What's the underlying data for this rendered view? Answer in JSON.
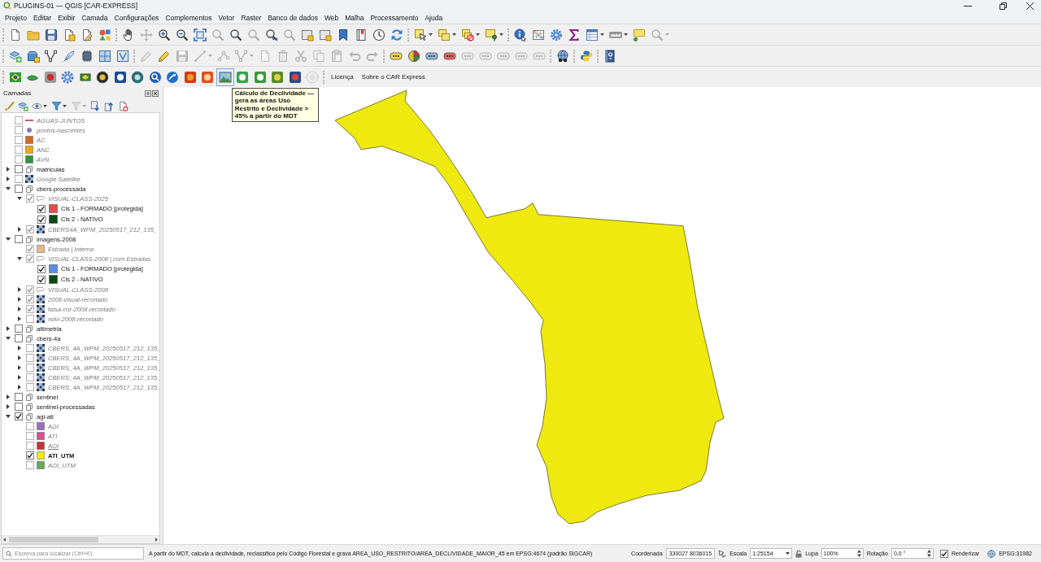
{
  "window": {
    "title": "PLUGINS-01 — QGIS [CAR-EXPRESS]"
  },
  "menu": [
    "Projeto",
    "Editar",
    "Exibir",
    "Camada",
    "Configurações",
    "Complementos",
    "Vetor",
    "Raster",
    "Banco de dados",
    "Web",
    "Malha",
    "Processamento",
    "Ajuda"
  ],
  "toolbars": [
    {
      "buttons": [
        {
          "disabled": false
        },
        {
          "disabled": false
        },
        {
          "disabled": false
        },
        {
          "disabled": false
        },
        {
          "disabled": false
        },
        {
          "disabled": false
        },
        {
          "disabled": false
        },
        {
          "disabled": true
        },
        {
          "disabled": false
        },
        {
          "disabled": false
        },
        {
          "disabled": false
        },
        {
          "disabled": true
        },
        {
          "disabled": false
        },
        {
          "disabled": true
        },
        {
          "disabled": false
        },
        {
          "disabled": true
        },
        {
          "disabled": false
        },
        {
          "disabled": false
        },
        {
          "disabled": false
        },
        {
          "disabled": false
        },
        {
          "disabled": false
        },
        {
          "disabled": false
        },
        {
          "disabled": false
        },
        {
          "disabled": false
        },
        {
          "disabled": false
        },
        {
          "disabled": false
        },
        {
          "disabled": false
        },
        {
          "disabled": false
        },
        {
          "disabled": false
        },
        {
          "disabled": false
        },
        {
          "disabled": false
        },
        {
          "disabled": false
        },
        {
          "disabled": false
        },
        {
          "disabled": true
        }
      ]
    },
    {
      "buttons": [
        {
          "disabled": false
        },
        {
          "disabled": false
        },
        {
          "disabled": false
        },
        {
          "disabled": false
        },
        {
          "disabled": false
        },
        {
          "disabled": false
        },
        {
          "disabled": false
        },
        {
          "disabled": true
        },
        {
          "disabled": false
        },
        {
          "disabled": true
        },
        {
          "disabled": true
        },
        {
          "disabled": true
        },
        {
          "disabled": true
        },
        {
          "disabled": true
        },
        {
          "disabled": true
        },
        {
          "disabled": true
        },
        {
          "disabled": true
        },
        {
          "disabled": true
        },
        {
          "disabled": true
        },
        {
          "disabled": true
        },
        {
          "disabled": false
        },
        {
          "disabled": false
        },
        {
          "disabled": false
        },
        {
          "disabled": false
        },
        {
          "disabled": true
        },
        {
          "disabled": true
        },
        {
          "disabled": true
        },
        {
          "disabled": true
        },
        {
          "disabled": true
        },
        {
          "disabled": false
        },
        {
          "disabled": false
        },
        {
          "disabled": false
        }
      ]
    },
    {
      "buttons": [
        {
          "disabled": false,
          "hovered": false
        },
        {
          "disabled": false,
          "hovered": false
        },
        {
          "disabled": false,
          "hovered": false
        },
        {
          "disabled": false,
          "hovered": false
        },
        {
          "disabled": false,
          "hovered": false
        },
        {
          "disabled": false,
          "hovered": false
        },
        {
          "disabled": false,
          "hovered": false
        },
        {
          "disabled": false,
          "hovered": false
        },
        {
          "disabled": false,
          "hovered": false
        },
        {
          "disabled": false,
          "hovered": false
        },
        {
          "disabled": false,
          "hovered": false
        },
        {
          "disabled": false,
          "hovered": false
        },
        {
          "disabled": false,
          "hovered": true,
          "tooltip": "Cálculo de Declividade — gera as áreas Uso Restrito e Declividade > 45% a partir do MDT"
        },
        {
          "disabled": false,
          "hovered": false
        },
        {
          "disabled": false,
          "hovered": false
        },
        {
          "disabled": false,
          "hovered": false
        },
        {
          "disabled": false,
          "hovered": false
        },
        {
          "disabled": true,
          "hovered": false
        }
      ],
      "actions": [
        "Licença",
        "Sobre o CAR Express"
      ]
    }
  ],
  "layers_panel": {
    "title": "Camadas",
    "tools": [
      {
        "disabled": false
      },
      {
        "disabled": false
      },
      {
        "disabled": false
      },
      {
        "disabled": false
      },
      {
        "disabled": true
      },
      {
        "disabled": false
      },
      {
        "disabled": false
      },
      {
        "disabled": false
      }
    ],
    "tree": [
      {
        "name": "AGUAS-JUNTOS",
        "kind": "line",
        "color": "#c8577e",
        "checked": false,
        "faded": true
      },
      {
        "name": "pontos-nascentes",
        "kind": "point",
        "color": "#8878b0",
        "checked": false,
        "faded": true
      },
      {
        "name": "AC",
        "kind": "fill",
        "color": "#cd6b27",
        "checked": false,
        "faded": true
      },
      {
        "name": "ANC",
        "kind": "fill",
        "color": "#f4a51e",
        "checked": false,
        "faded": true
      },
      {
        "name": "AVN",
        "kind": "fill",
        "color": "#2e963a",
        "checked": false,
        "faded": true
      },
      {
        "name": "matriculas",
        "kind": "group",
        "checked": false,
        "faded": false,
        "expanded": false
      },
      {
        "name": "Google Satellite",
        "kind": "raster",
        "checked": false,
        "faded": true,
        "expanded": false
      },
      {
        "name": "cbers-processada",
        "kind": "group",
        "checked": false,
        "faded": false,
        "expanded": true,
        "children": [
          {
            "name": "VISUAL-CLASS-2025",
            "kind": "categorized",
            "checked": true,
            "faded": true,
            "expanded": true,
            "children": [
              {
                "name": "Cls 1 - FORMADO [protegida]",
                "kind": "class",
                "color": "#e04f4a",
                "checked": true,
                "faded": false
              },
              {
                "name": "Cls 2 - NATIVO",
                "kind": "class",
                "color": "#0c4715",
                "checked": true,
                "faded": false
              }
            ]
          },
          {
            "name": "CBERS4A_WPM_20250517_212_135_",
            "kind": "raster",
            "checked": true,
            "faded": true,
            "expanded": false
          }
        ]
      },
      {
        "name": "imagens-2008",
        "kind": "group",
        "checked": false,
        "faded": false,
        "expanded": true,
        "children": [
          {
            "name": "Estrada | Interna",
            "kind": "fill",
            "color": "#e7b98c",
            "checked": true,
            "faded": true
          },
          {
            "name": "VISUAL-CLASS-2008 | com Estradas",
            "kind": "categorized",
            "checked": true,
            "faded": true,
            "expanded": true,
            "children": [
              {
                "name": "Cls 1 - FORMADO [protegida]",
                "kind": "class",
                "color": "#5a8de4",
                "checked": true,
                "faded": false
              },
              {
                "name": "Cls 2 - NATIVO",
                "kind": "class",
                "color": "#0c4715",
                "checked": true,
                "faded": false
              }
            ]
          },
          {
            "name": "VISUAL-CLASS-2008",
            "kind": "categorized",
            "checked": true,
            "faded": true,
            "expanded": false
          },
          {
            "name": "2008-visual-recortado",
            "kind": "raster",
            "checked": true,
            "faded": true,
            "expanded": false
          },
          {
            "name": "falsa-cor-2008-recortado",
            "kind": "raster",
            "checked": true,
            "faded": true,
            "expanded": false
          },
          {
            "name": "ndvi-2008-recortado",
            "kind": "raster",
            "checked": false,
            "faded": true,
            "expanded": false
          }
        ]
      },
      {
        "name": "altimetria",
        "kind": "group",
        "checked": false,
        "faded": false,
        "expanded": false
      },
      {
        "name": "cbers-4a",
        "kind": "group",
        "checked": false,
        "faded": false,
        "expanded": true,
        "children": [
          {
            "name": "CBERS_4A_WPM_20250517_212_135_",
            "kind": "raster",
            "checked": false,
            "faded": true,
            "expanded": false
          },
          {
            "name": "CBERS_4A_WPM_20250517_212_135_",
            "kind": "raster",
            "checked": false,
            "faded": true,
            "expanded": false
          },
          {
            "name": "CBERS_4A_WPM_20250517_212_135_",
            "kind": "raster",
            "checked": false,
            "faded": true,
            "expanded": false
          },
          {
            "name": "CBERS_4A_WPM_20250517_212_135_",
            "kind": "raster",
            "checked": false,
            "faded": true,
            "expanded": false
          },
          {
            "name": "CBERS_4A_WPM_20250517_212_135_",
            "kind": "raster",
            "checked": false,
            "faded": true,
            "expanded": false
          }
        ]
      },
      {
        "name": "sentinel",
        "kind": "group",
        "checked": false,
        "faded": false,
        "expanded": false
      },
      {
        "name": "sentinel-processadas",
        "kind": "group",
        "checked": false,
        "faded": false,
        "expanded": false
      },
      {
        "name": "agi-ati",
        "kind": "group",
        "checked": true,
        "faded": false,
        "expanded": true,
        "children": [
          {
            "name": "AGI",
            "kind": "fill",
            "color": "#9b6cc6",
            "checked": false,
            "faded": true
          },
          {
            "name": "ATI",
            "kind": "fill",
            "color": "#d9508b",
            "checked": false,
            "faded": true
          },
          {
            "name": "AOI",
            "kind": "fill",
            "color": "#c83434",
            "checked": false,
            "faded": true,
            "underlined": true
          },
          {
            "name": "ATI_UTM",
            "kind": "fill",
            "color": "#f1e90f",
            "checked": true,
            "faded": false,
            "bold": true
          },
          {
            "name": "AOI_UTM",
            "kind": "fill",
            "color": "#6aa95c",
            "checked": false,
            "faded": true
          }
        ]
      }
    ]
  },
  "status_bar": {
    "locator": {
      "placeholder": "Escreva para localizar (Ctrl+K)"
    },
    "message": "A partir do MDT, calcula a declividade, reclassifica pelo Código Florestal e grava AREA_USO_RESTRITO/AREA_DECLIVIDADE_MAIOR_45 em EPSG:4674 (padrão SIGCAR)",
    "coordinate": {
      "label": "Coordenada",
      "value": "330027 8036015"
    },
    "scale": {
      "label": "Escala",
      "value": "1:25154"
    },
    "magnifier": {
      "label": "Lupa",
      "value": "100%"
    },
    "rotation": {
      "label": "Rotação",
      "value": "0,0 °"
    },
    "render": {
      "label": "Renderizar",
      "checked": true
    },
    "crs": "EPSG:31982"
  }
}
